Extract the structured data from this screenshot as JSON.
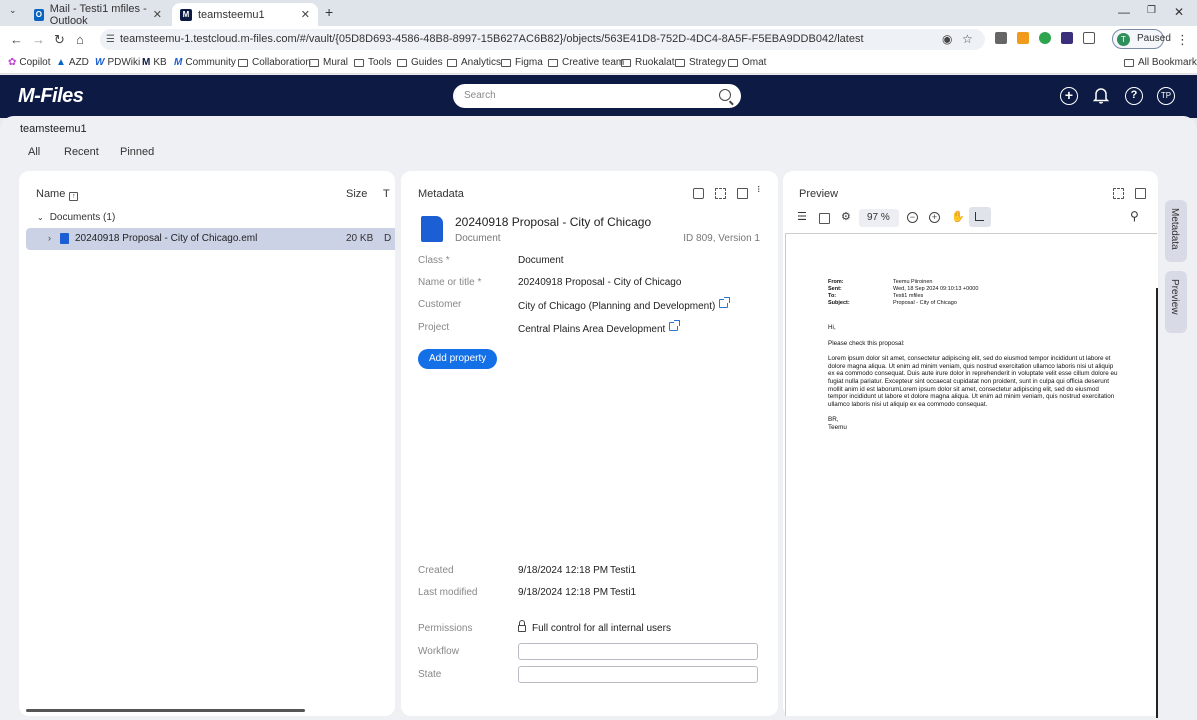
{
  "browser": {
    "tabs": [
      {
        "label": "Mail - Testi1 mfiles - Outlook"
      },
      {
        "label": "teamsteemu1"
      }
    ],
    "new_tab": "+",
    "url": "teamsteemu-1.testcloud.m-files.com/#/vault/{05D8D693-4586-48B8-8997-15B627AC6B82}/objects/563E41D8-752D-4DC4-8A5F-F5EBA9DDB042/latest",
    "profile_initial": "T",
    "profile_status": "Paused",
    "bookmarks": [
      "Copilot",
      "AZD",
      "PDWiki",
      "KB",
      "Community",
      "Collaboration",
      "Mural",
      "Tools",
      "Guides",
      "Analytics",
      "Figma",
      "Creative team",
      "Ruokalat",
      "Strategy",
      "Omat"
    ],
    "all_bookmarks": "All Bookmarks"
  },
  "app": {
    "logo": "M-Files",
    "search_placeholder": "Search",
    "user_initials": "TP",
    "help": "?",
    "add": "+"
  },
  "vault": {
    "name": "teamsteemu1",
    "tabs": [
      "All",
      "Recent",
      "Pinned"
    ]
  },
  "listing": {
    "columns": {
      "name": "Name",
      "size": "Size",
      "type": "T"
    },
    "group": "Documents (1)",
    "items": [
      {
        "name": "20240918 Proposal - City of Chicago.eml",
        "size": "20 KB",
        "type": "D"
      }
    ]
  },
  "metadata": {
    "title": "Metadata",
    "doc_title": "20240918 Proposal - City of Chicago",
    "doc_type": "Document",
    "doc_id": "ID 809, Version 1",
    "properties": [
      {
        "label": "Class *",
        "value": "Document"
      },
      {
        "label": "Name or title *",
        "value": "20240918 Proposal - City of Chicago"
      },
      {
        "label": "Customer",
        "value": "City of Chicago (Planning and Development)"
      },
      {
        "label": "Project",
        "value": "Central Plains Area Development"
      }
    ],
    "add_property": "Add property",
    "created_label": "Created",
    "created_date": "9/18/2024 12:18 PM",
    "created_by": "Testi1",
    "modified_label": "Last modified",
    "modified_date": "9/18/2024 12:18 PM",
    "modified_by": "Testi1",
    "permissions_label": "Permissions",
    "permissions_value": "Full control for all internal users",
    "workflow_label": "Workflow",
    "workflow_value": "",
    "state_label": "State",
    "state_value": ""
  },
  "preview": {
    "title": "Preview",
    "zoom": "97 %",
    "email": {
      "from_label": "From:",
      "from": "Teemu Piiroinen",
      "sent_label": "Sent:",
      "sent": "Wed, 18 Sep 2024 09:10:13 +0000",
      "to_label": "To:",
      "to": "Testi1 mfiles",
      "subject_label": "Subject:",
      "subject": "Proposal - City of Chicago",
      "greeting": "Hi,",
      "intro": "Please check this proposal:",
      "body": "Lorem ipsum dolor sit amet, consectetur adipiscing elit, sed do eiusmod tempor incididunt ut labore et dolore magna aliqua. Ut enim ad minim veniam, quis nostrud exercitation ullamco laboris nisi ut aliquip ex ea commodo consequat. Duis aute irure dolor in reprehenderit in voluptate velit esse cillum dolore eu fugiat nulla pariatur. Excepteur sint occaecat cupidatat non proident, sunt in culpa qui officia deserunt mollit anim id est laborumLorem ipsum dolor sit amet, consectetur adipiscing elit, sed do eiusmod tempor incididunt ut labore et dolore magna aliqua. Ut enim ad minim veniam, quis nostrud exercitation ullamco laboris nisi ut aliquip ex ea commodo consequat.",
      "sign1": "BR,",
      "sign2": "Teemu"
    }
  },
  "side_tabs": [
    "Metadata",
    "Preview"
  ],
  "colors": {
    "header_bg": "#0d1b44",
    "accent": "#1470e6",
    "selected_row": "#ccd2e6"
  }
}
